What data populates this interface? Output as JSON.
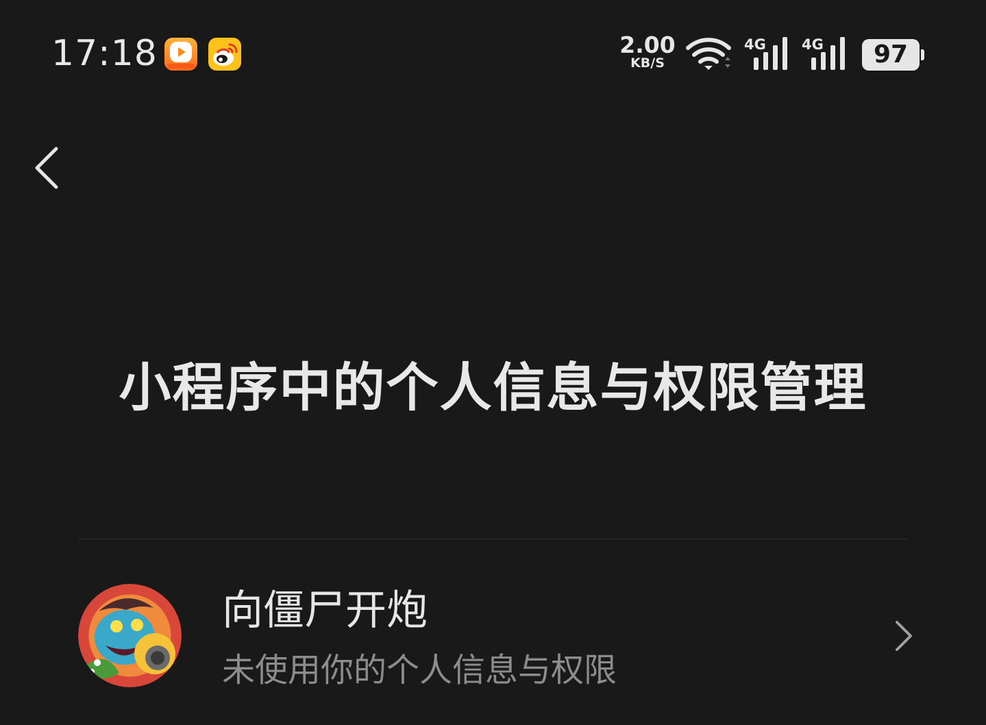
{
  "status_bar": {
    "time": "17:18",
    "net_speed_value": "2.00",
    "net_speed_unit": "KB/S",
    "network_1": "4G",
    "network_2": "4G",
    "battery": "97"
  },
  "title": "小程序中的个人信息与权限管理",
  "list": [
    {
      "name": "向僵尸开炮",
      "desc": "未使用你的个人信息与权限"
    }
  ],
  "icons": {
    "back": "chevron-left-icon",
    "item_arrow": "chevron-right-icon",
    "app_video": "video-app-icon",
    "app_weibo": "weibo-icon",
    "wifi": "wifi-icon",
    "signal": "cellular-signal-icon",
    "battery": "battery-icon"
  },
  "colors": {
    "background": "#191919",
    "text_primary": "#e6e6e6",
    "text_secondary": "#8c8c8c",
    "divider": "#2f2f2f"
  }
}
